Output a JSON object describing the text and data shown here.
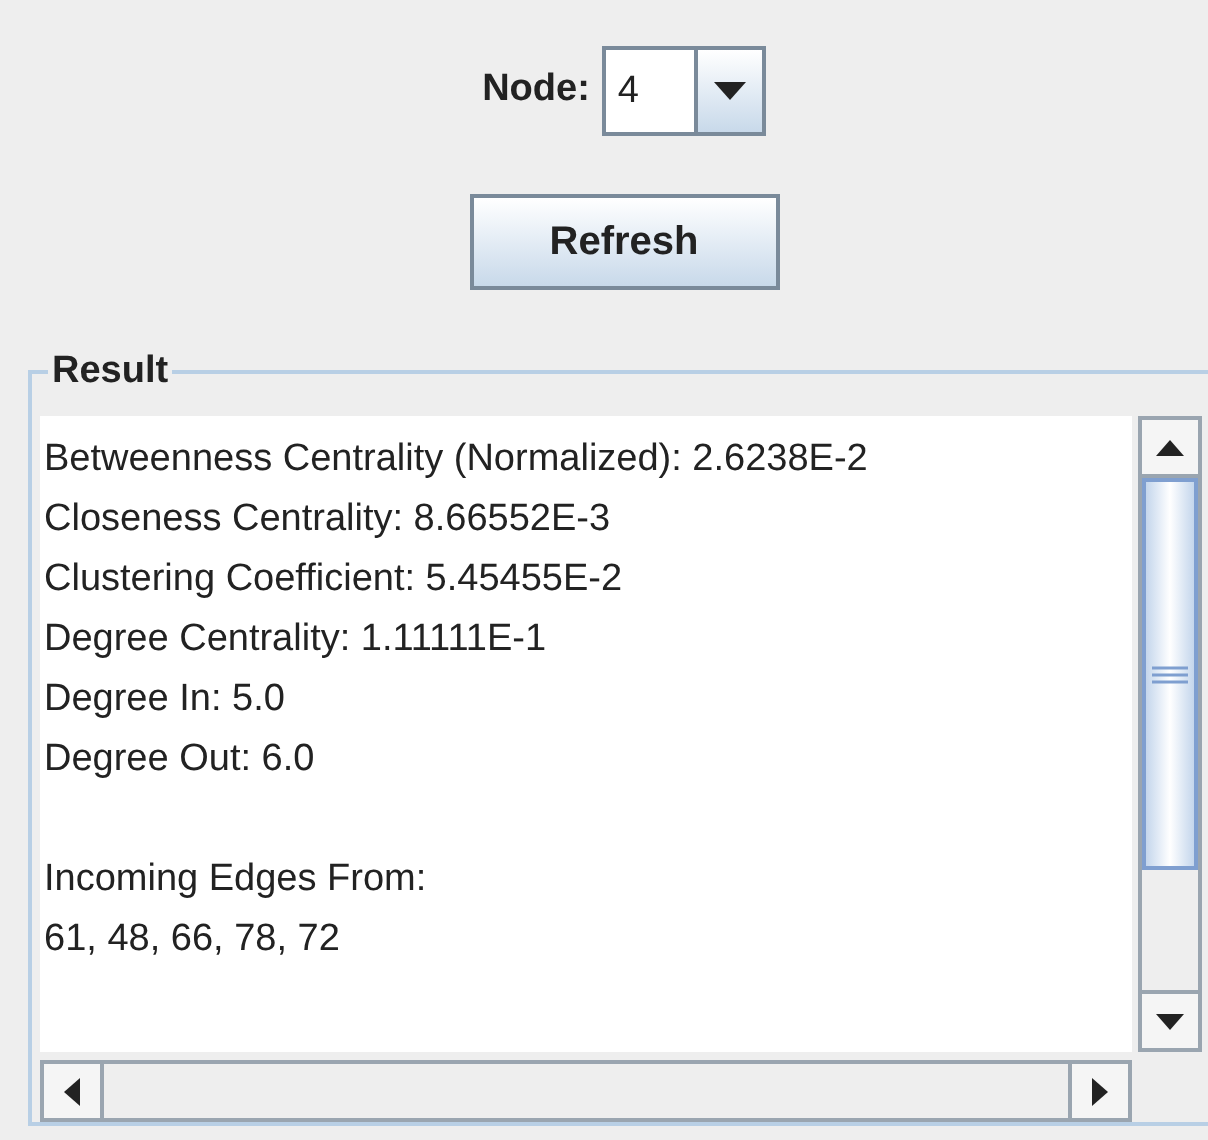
{
  "node_selector": {
    "label": "Node:",
    "value": "4"
  },
  "refresh_button": "Refresh",
  "result": {
    "title": "Result",
    "paragraphs": [
      [
        "Betweenness Centrality (Normalized): 2.6238E-2",
        "Closeness Centrality: 8.66552E-3",
        "Clustering Coefficient: 5.45455E-2",
        "Degree Centrality: 1.11111E-1",
        "Degree In: 5.0",
        "Degree Out: 6.0"
      ],
      [
        "Incoming Edges From:",
        "61, 48, 66, 78, 72"
      ]
    ]
  }
}
